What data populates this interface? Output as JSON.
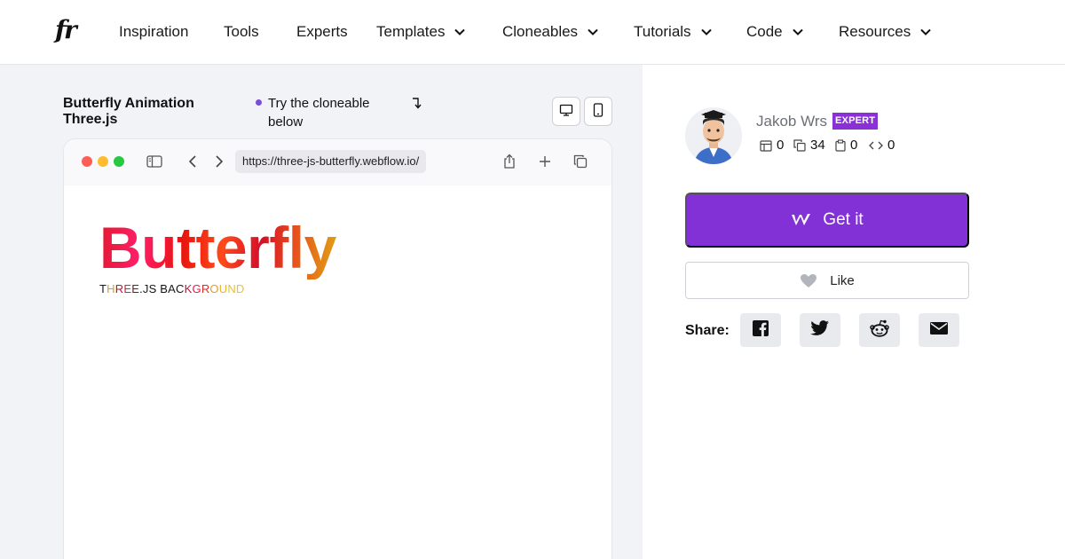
{
  "nav": {
    "logo": "fr",
    "items": [
      {
        "label": "Inspiration",
        "dropdown": false
      },
      {
        "label": "Tools",
        "dropdown": false
      },
      {
        "label": "Experts",
        "dropdown": false
      },
      {
        "label": "Templates",
        "dropdown": true
      },
      {
        "label": "Cloneables",
        "dropdown": true
      },
      {
        "label": "Tutorials",
        "dropdown": true
      },
      {
        "label": "Code",
        "dropdown": true
      },
      {
        "label": "Resources",
        "dropdown": true
      }
    ]
  },
  "preview": {
    "title": "Butterfly Animation Three.js",
    "hint": "Try the cloneable below",
    "view_modes": [
      "desktop-icon",
      "mobile-icon"
    ],
    "browser": {
      "url": "https://three-js-butterfly.webflow.io/",
      "site_title": "Butterfly",
      "site_subtitle": "THREE.JS BACKGROUND"
    }
  },
  "author": {
    "name": "Jakob Wrs",
    "badge": "EXPERT",
    "stats": [
      {
        "icon": "layout-icon",
        "value": "0"
      },
      {
        "icon": "clone-icon",
        "value": "34"
      },
      {
        "icon": "clipboard-icon",
        "value": "0"
      },
      {
        "icon": "code-icon",
        "value": "0"
      }
    ]
  },
  "actions": {
    "get_it": "Get it",
    "like": "Like",
    "share_label": "Share:",
    "share_targets": [
      "facebook-icon",
      "twitter-icon",
      "reddit-icon",
      "email-icon"
    ]
  },
  "colors": {
    "accent": "#8131d6",
    "badge": "#8b2fd6",
    "left_bg": "#f2f3f7"
  }
}
